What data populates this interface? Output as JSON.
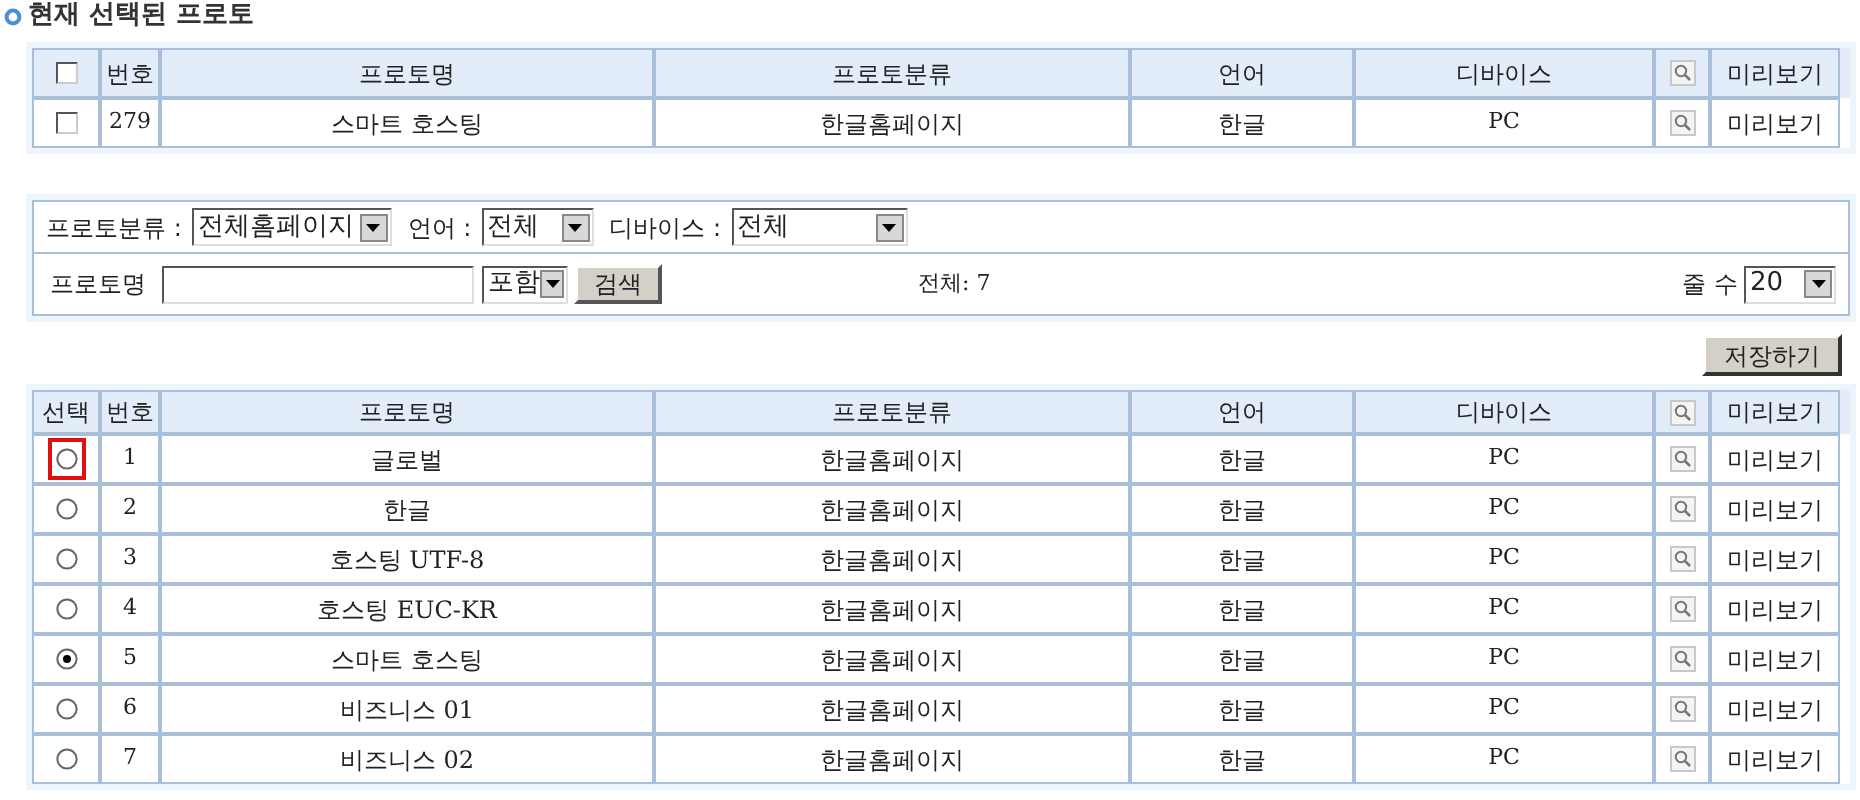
{
  "section_title": "현재 선택된 프로토",
  "current_table": {
    "select_all_checked": false,
    "columns": [
      "번호",
      "프로토명",
      "프로토분류",
      "언어",
      "디바이스",
      "미리보기"
    ],
    "rows": [
      {
        "checked": false,
        "number": "279",
        "name": "스마트 호스팅",
        "category": "한글홈페이지",
        "language": "한글",
        "device": "PC",
        "preview": "미리보기"
      }
    ]
  },
  "filters": {
    "category_label": "프로토분류 :",
    "category_value": "전체홈페이지",
    "language_label": "언어 :",
    "language_value": "전체",
    "device_label": "디바이스 :",
    "device_value": "전체",
    "name_label": "프로토명",
    "match_value": "포함",
    "search_button": "검색",
    "total": "전체: 7",
    "rows_label": "줄 수",
    "rows_value": "20"
  },
  "save_button": "저장하기",
  "list_table": {
    "columns": [
      "선택",
      "번호",
      "프로토명",
      "프로토분류",
      "언어",
      "디바이스",
      "미리보기"
    ],
    "rows": [
      {
        "selected": false,
        "highlighted": true,
        "number": "1",
        "name": "글로벌",
        "category": "한글홈페이지",
        "language": "한글",
        "device": "PC",
        "preview": "미리보기"
      },
      {
        "selected": false,
        "highlighted": false,
        "number": "2",
        "name": "한글",
        "category": "한글홈페이지",
        "language": "한글",
        "device": "PC",
        "preview": "미리보기"
      },
      {
        "selected": false,
        "highlighted": false,
        "number": "3",
        "name": "호스팅 UTF-8",
        "category": "한글홈페이지",
        "language": "한글",
        "device": "PC",
        "preview": "미리보기"
      },
      {
        "selected": false,
        "highlighted": false,
        "number": "4",
        "name": "호스팅 EUC-KR",
        "category": "한글홈페이지",
        "language": "한글",
        "device": "PC",
        "preview": "미리보기"
      },
      {
        "selected": true,
        "highlighted": false,
        "number": "5",
        "name": "스마트 호스팅",
        "category": "한글홈페이지",
        "language": "한글",
        "device": "PC",
        "preview": "미리보기"
      },
      {
        "selected": false,
        "highlighted": false,
        "number": "6",
        "name": "비즈니스 01",
        "category": "한글홈페이지",
        "language": "한글",
        "device": "PC",
        "preview": "미리보기"
      },
      {
        "selected": false,
        "highlighted": false,
        "number": "7",
        "name": "비즈니스 02",
        "category": "한글홈페이지",
        "language": "한글",
        "device": "PC",
        "preview": "미리보기"
      }
    ]
  }
}
